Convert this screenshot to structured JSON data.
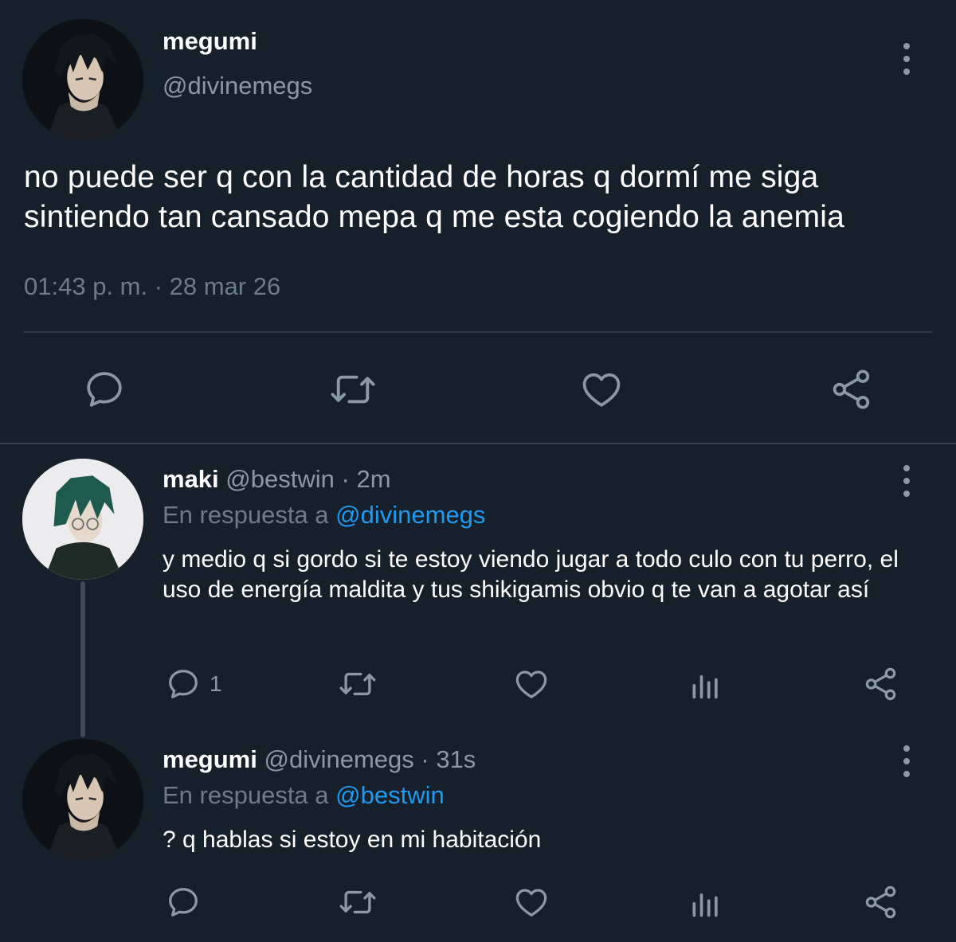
{
  "colors": {
    "background": "#15202b",
    "text_primary": "#ffffff",
    "text_secondary": "#8b98a5",
    "text_muted": "#6e7c89",
    "accent": "#1d9bf0",
    "divider": "#38444d"
  },
  "main_tweet": {
    "name": "megumi",
    "handle": "@divinemegs",
    "text": "no puede ser q con la cantidad de horas q dormí me siga sintiendo tan cansado mepa q me esta cogiendo la anemia",
    "timestamp": "01:43 p. m. · 28 mar 26",
    "actions": [
      "reply-icon",
      "retweet-icon",
      "like-icon",
      "share-icon"
    ]
  },
  "replies": [
    {
      "name": "maki",
      "handle": "@bestwin",
      "time": "· 2m",
      "reply_to_prefix": "En respuesta a",
      "reply_to_mention": "@divinemegs",
      "text": "y medio q si gordo si te estoy viendo jugar a todo culo con tu perro, el uso de energía maldita y tus shikigamis obvio q te van a agotar así",
      "reply_count": "1",
      "actions": [
        "reply-icon",
        "retweet-icon",
        "like-icon",
        "analytics-icon",
        "share-icon"
      ]
    },
    {
      "name": "megumi",
      "handle": "@divinemegs",
      "time": "· 31s",
      "reply_to_prefix": "En respuesta a",
      "reply_to_mention": "@bestwin",
      "text": "? q hablas si estoy en mi habitación",
      "reply_count": "",
      "actions": [
        "reply-icon",
        "retweet-icon",
        "like-icon",
        "analytics-icon",
        "share-icon"
      ]
    }
  ]
}
